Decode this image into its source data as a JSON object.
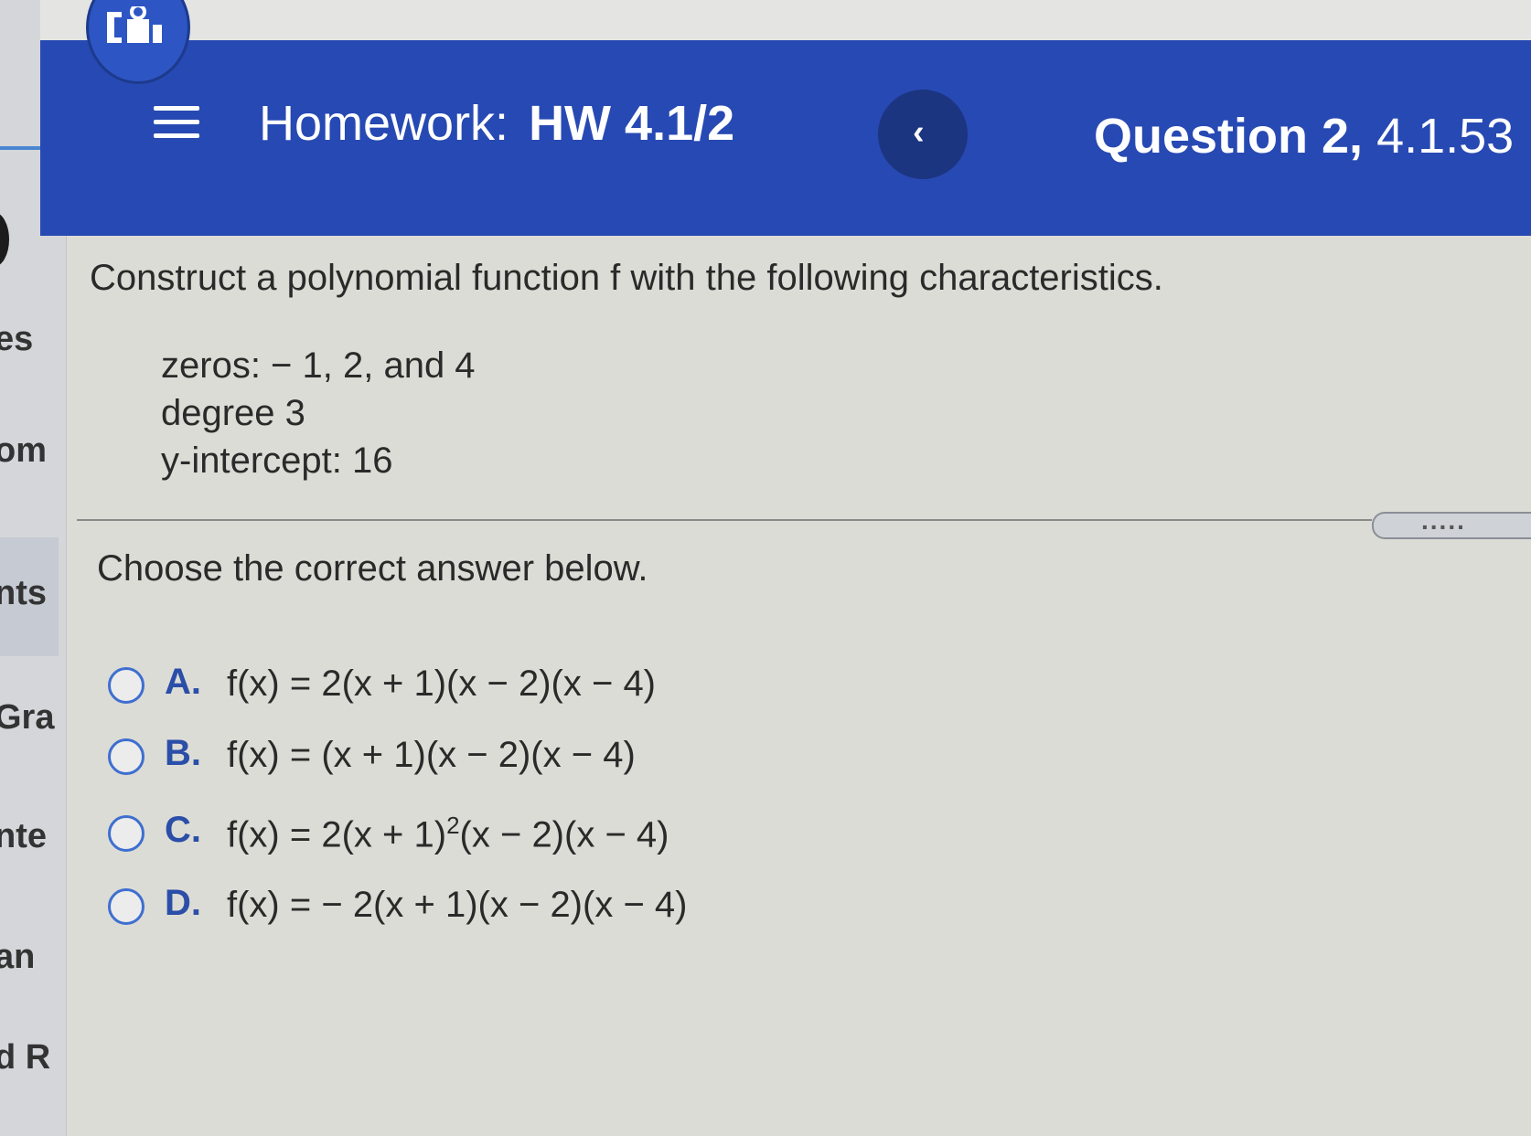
{
  "sidebar": {
    "fragments": [
      "es",
      "om",
      "nts",
      "Gra",
      "nte",
      "an",
      "d R"
    ]
  },
  "header": {
    "title_prefix": "Homework:",
    "title_name": "HW 4.1/2",
    "prev_icon": "chevron-left-icon",
    "question_label": "Question 2,",
    "question_number": "4.1.53",
    "color": "#2749b3"
  },
  "question": {
    "prompt": "Construct a polynomial function f with the following characteristics.",
    "characteristics": [
      "zeros:  − 1, 2, and 4",
      "degree 3",
      "y-intercept: 16"
    ]
  },
  "expand": {
    "label": "....."
  },
  "answers": {
    "instruction": "Choose the correct answer below.",
    "options": [
      {
        "letter": "A.",
        "expr": "f(x) = 2(x + 1)(x − 2)(x − 4)"
      },
      {
        "letter": "B.",
        "expr": "f(x) = (x + 1)(x − 2)(x − 4)"
      },
      {
        "letter": "C.",
        "expr_pre": "f(x) = 2(x + 1)",
        "expr_sup": "2",
        "expr_post": "(x − 2)(x − 4)"
      },
      {
        "letter": "D.",
        "expr": "f(x) =  − 2(x + 1)(x − 2)(x − 4)"
      }
    ]
  }
}
